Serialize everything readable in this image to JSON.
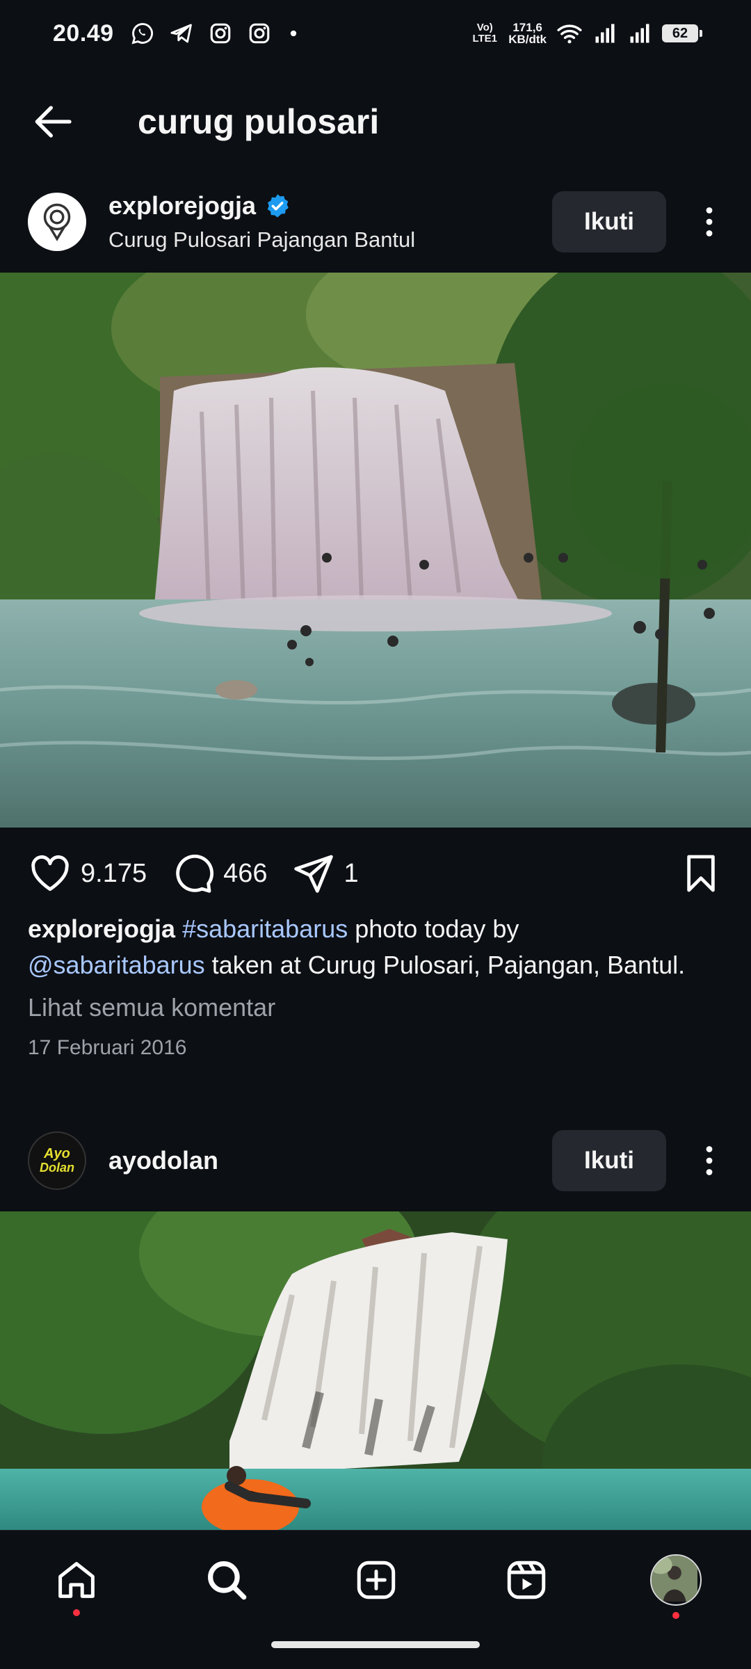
{
  "status_bar": {
    "time": "20.49",
    "notification_icons": [
      "whatsapp-icon",
      "telegram-icon",
      "instagram-icon",
      "instagram-icon",
      "dot-icon"
    ],
    "network_type": "Vo) LTE1",
    "speed": "171,6",
    "speed_unit": "KB/dtk",
    "battery": "62"
  },
  "header": {
    "back_icon": "back-arrow-icon",
    "title": "curug pulosari"
  },
  "posts": [
    {
      "username": "explorejogja",
      "verified": true,
      "location": "Curug Pulosari Pajangan Bantul",
      "follow_label": "Ikuti",
      "likes": "9.175",
      "comments": "466",
      "shares": "1",
      "caption_user": "explorejogja",
      "caption_hashtag": "#sabaritabarus",
      "caption_text1": " photo today by",
      "caption_mention": "@sabaritabarus",
      "caption_text2": " taken at Curug Pulosari, Pajangan, Bantul.",
      "view_comments": "Lihat semua komentar",
      "date": "17 Februari 2016"
    },
    {
      "username": "ayodolan",
      "avatar_text_line1": "Ayo",
      "avatar_text_line2": "Dolan",
      "follow_label": "Ikuti"
    }
  ],
  "bottom_nav": {
    "items": [
      "home-icon",
      "search-icon",
      "create-icon",
      "reels-icon",
      "profile-avatar"
    ]
  },
  "colors": {
    "background": "#0c0f14",
    "button": "#25282e",
    "link": "#a9c8ff",
    "muted": "#9ea3aa",
    "verified": "#1d9bf0",
    "notification_dot": "#ff3040"
  }
}
